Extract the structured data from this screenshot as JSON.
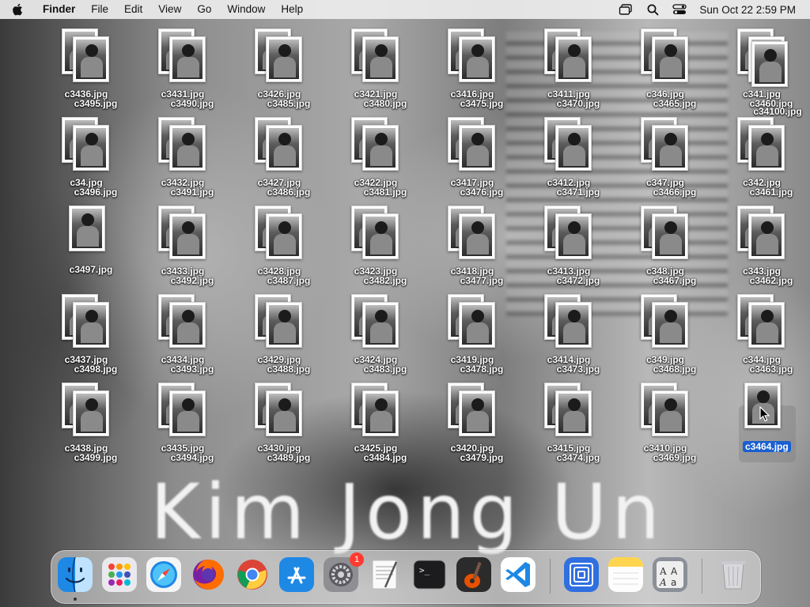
{
  "menubar": {
    "app_name": "Finder",
    "menus": [
      "File",
      "Edit",
      "View",
      "Go",
      "Window",
      "Help"
    ],
    "clock": "Sun Oct 22  2:59 PM"
  },
  "wallpaper": {
    "caption": "Kim Jong Un"
  },
  "desktop": {
    "files": [
      "c3436.jpg",
      "c3495.jpg",
      "c3431.jpg",
      "c3490.jpg",
      "c3426.jpg",
      "c3485.jpg",
      "c3421.jpg",
      "c3480.jpg",
      "c3416.jpg",
      "c3475.jpg",
      "c3411.jpg",
      "c3470.jpg",
      "c346.jpg",
      "c3465.jpg",
      "c341.jpg",
      "c3460.jpg",
      "c34100.jpg",
      "c34.jpg",
      "c3496.jpg",
      "c3432.jpg",
      "c3491.jpg",
      "c3427.jpg",
      "c3486.jpg",
      "c3422.jpg",
      "c3481.jpg",
      "c3417.jpg",
      "c3476.jpg",
      "c3412.jpg",
      "c3471.jpg",
      "c347.jpg",
      "c3466.jpg",
      "c342.jpg",
      "c3461.jpg",
      "c3497.jpg",
      "c3433.jpg",
      "c3492.jpg",
      "c3428.jpg",
      "c3487.jpg",
      "c3423.jpg",
      "c3482.jpg",
      "c3418.jpg",
      "c3477.jpg",
      "c3413.jpg",
      "c3472.jpg",
      "c348.jpg",
      "c3467.jpg",
      "c343.jpg",
      "c3462.jpg",
      "c3437.jpg",
      "c3498.jpg",
      "c3434.jpg",
      "c3493.jpg",
      "c3429.jpg",
      "c3488.jpg",
      "c3424.jpg",
      "c3483.jpg",
      "c3419.jpg",
      "c3478.jpg",
      "c3414.jpg",
      "c3473.jpg",
      "c349.jpg",
      "c3468.jpg",
      "c344.jpg",
      "c3463.jpg",
      "c3438.jpg",
      "c3499.jpg",
      "c3435.jpg",
      "c3494.jpg",
      "c3430.jpg",
      "c3489.jpg",
      "c3425.jpg",
      "c3484.jpg",
      "c3420.jpg",
      "c3479.jpg",
      "c3415.jpg",
      "c3474.jpg",
      "c3410.jpg",
      "c3469.jpg",
      "c3464.jpg"
    ],
    "selected_file": "c3464.jpg"
  },
  "dock": {
    "apps": [
      {
        "name": "finder-icon",
        "running": true
      },
      {
        "name": "launchpad-icon",
        "running": false
      },
      {
        "name": "safari-icon",
        "running": false
      },
      {
        "name": "firefox-icon",
        "running": false
      },
      {
        "name": "chrome-icon",
        "running": false
      },
      {
        "name": "app-store-icon",
        "running": false
      },
      {
        "name": "system-preferences-icon",
        "running": false,
        "badge": "1"
      },
      {
        "name": "textedit-icon",
        "running": false
      },
      {
        "name": "terminal-icon",
        "running": false
      },
      {
        "name": "garageband-icon",
        "running": false
      },
      {
        "name": "vscode-icon",
        "running": false
      },
      {
        "name": "software-update-icon",
        "running": false
      },
      {
        "name": "notes-icon",
        "running": false
      },
      {
        "name": "font-book-icon",
        "running": false
      },
      {
        "name": "trash-icon",
        "running": false
      }
    ],
    "system_preferences_badge": "1"
  },
  "colors": {
    "selection": "#1a5fd0",
    "badge": "#ff3b30"
  }
}
